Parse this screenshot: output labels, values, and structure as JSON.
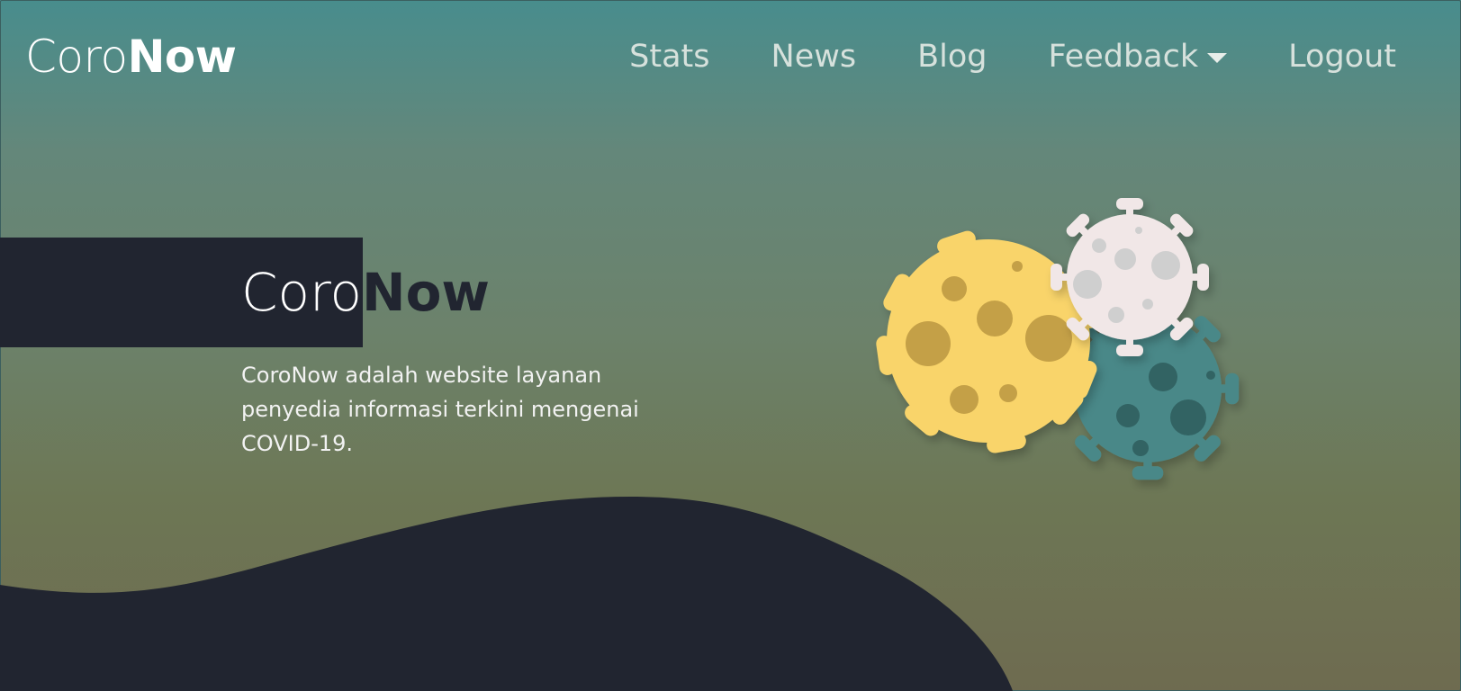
{
  "brand": {
    "part1": "Coro",
    "part2": "Now"
  },
  "nav": {
    "items": [
      {
        "label": "Stats"
      },
      {
        "label": "News"
      },
      {
        "label": "Blog"
      },
      {
        "label": "Feedback",
        "has_dropdown": true
      },
      {
        "label": "Logout"
      }
    ]
  },
  "hero": {
    "title_part1": "Coro",
    "title_part2": "Now",
    "description": "CoroNow adalah website layanan penyedia informasi terkini mengenai COVID-19."
  },
  "colors": {
    "background_top": "#488d8d",
    "background_bottom": "#6e6b50",
    "dark_navy": "#212530",
    "virus_yellow": "#f9d46a",
    "virus_teal": "#4a8888",
    "virus_white": "#f1e7e7"
  },
  "illustration": {
    "icon": "coronavirus-icon"
  }
}
